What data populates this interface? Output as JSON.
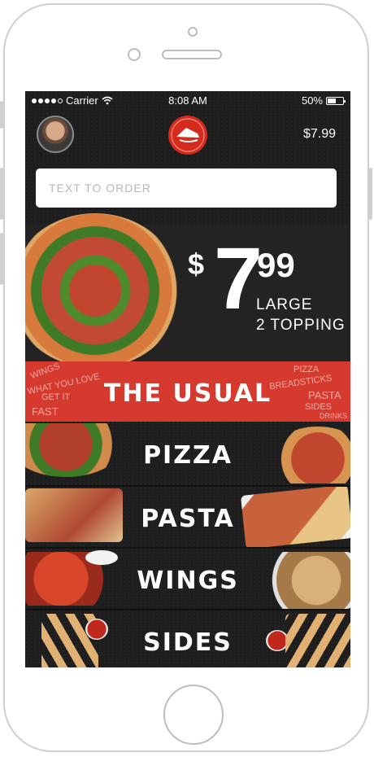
{
  "status": {
    "carrier": "Carrier",
    "time": "8:08 AM",
    "battery": "50%"
  },
  "header": {
    "price": "$7.99"
  },
  "search": {
    "placeholder": "TEXT TO ORDER"
  },
  "promo": {
    "dollar": "$",
    "main": "7",
    "cents": "99",
    "line1": "LARGE",
    "line2": "2 TOPPING"
  },
  "menu": [
    {
      "label": "THE USUAL"
    },
    {
      "label": "PIZZA"
    },
    {
      "label": "PASTA"
    },
    {
      "label": "WINGS"
    },
    {
      "label": "SIDES"
    }
  ],
  "usual_scribbles": [
    "WINGS",
    "WHAT YOU LOVE",
    "GET IT",
    "FAST",
    "PIZZA",
    "BREADSTICKS",
    "PASTA",
    "SIDES",
    "DRINKS"
  ],
  "colors": {
    "brand_red": "#d6392d",
    "background": "#1e1e1e"
  }
}
